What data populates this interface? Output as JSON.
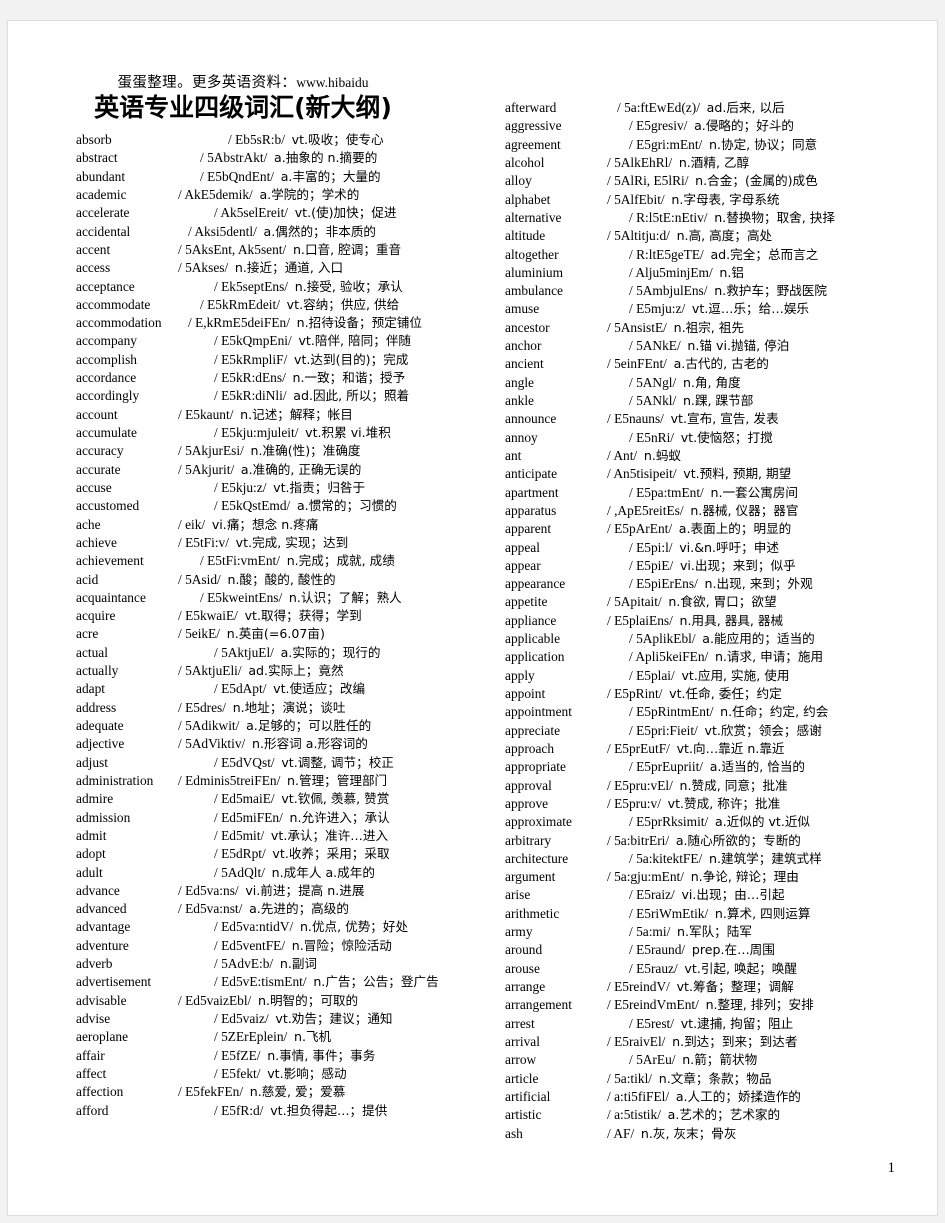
{
  "header": {
    "watermark_cn": "蛋蛋整理。更多英语资料：",
    "watermark_url": "www.hibaidu",
    "title": "英语专业四级词汇(新大纲)"
  },
  "page_number": "1",
  "columns": {
    "left": [
      {
        "word": "absorb",
        "gap": 5,
        "phonetic": "/ Eb5sR:b/",
        "definition": "vt.吸收；使专心"
      },
      {
        "word": "abstract",
        "gap": 3,
        "phonetic": "/ 5AbstrAkt/",
        "definition": "a.抽象的 n.摘要的"
      },
      {
        "word": "abundant",
        "gap": 3,
        "phonetic": "/ E5bQndEnt/",
        "definition": "a.丰富的；大量的"
      },
      {
        "word": "academic",
        "gap": 1,
        "phonetic": "/ AkE5demik/",
        "definition": "a.学院的；学术的"
      },
      {
        "word": "accelerate",
        "gap": 4,
        "phonetic": "/ Ak5selEreit/",
        "definition": "vt.(使)加快；促进"
      },
      {
        "word": "accidental",
        "gap": 2,
        "phonetic": "/ Aksi5dentl/",
        "definition": "a.偶然的；非本质的"
      },
      {
        "word": "accent",
        "gap": 1,
        "phonetic": "/ 5AksEnt, Ak5sent/",
        "definition": "n.口音, 腔调；重音"
      },
      {
        "word": "access",
        "gap": 1,
        "phonetic": "/ 5Akses/",
        "definition": "n.接近；通道, 入口"
      },
      {
        "word": "acceptance",
        "gap": 4,
        "phonetic": "/ Ek5septEns/",
        "definition": "n.接受, 验收；承认"
      },
      {
        "word": "accommodate",
        "gap": 3,
        "phonetic": "/ E5kRmEdeit/",
        "definition": "vt.容纳；供应, 供给"
      },
      {
        "word": "accommodation",
        "gap": 2,
        "phonetic": "/ E,kRmE5deiFEn/",
        "definition": "n.招待设备；预定铺位"
      },
      {
        "word": "accompany",
        "gap": 4,
        "phonetic": "/ E5kQmpEni/",
        "definition": "vt.陪伴, 陪同；伴随"
      },
      {
        "word": "accomplish",
        "gap": 4,
        "phonetic": "/ E5kRmpliF/",
        "definition": "vt.达到(目的)；完成"
      },
      {
        "word": "accordance",
        "gap": 4,
        "phonetic": "/ E5kR:dEns/",
        "definition": "n.一致；和谐；授予"
      },
      {
        "word": "accordingly",
        "gap": 4,
        "phonetic": "/ E5kR:diNli/",
        "definition": "ad.因此, 所以；照着"
      },
      {
        "word": "account",
        "gap": 1,
        "phonetic": "/ E5kaunt/",
        "definition": "n.记述；解释；帐目"
      },
      {
        "word": "accumulate",
        "gap": 4,
        "phonetic": "/ E5kju:mjuleit/",
        "definition": "vt.积累 vi.堆积"
      },
      {
        "word": "accuracy",
        "gap": 1,
        "phonetic": "/ 5AkjurEsi/",
        "definition": "n.准确(性)；准确度"
      },
      {
        "word": "accurate",
        "gap": 1,
        "phonetic": "/ 5Akjurit/",
        "definition": "a.准确的, 正确无误的"
      },
      {
        "word": "accuse",
        "gap": 4,
        "phonetic": "/ E5kju:z/",
        "definition": "vt.指责；归咎于"
      },
      {
        "word": "accustomed",
        "gap": 4,
        "phonetic": "/ E5kQstEmd/",
        "definition": "a.惯常的；习惯的"
      },
      {
        "word": "ache",
        "gap": 1,
        "phonetic": "/ eik/",
        "definition": "vi.痛；想念 n.疼痛"
      },
      {
        "word": "achieve",
        "gap": 1,
        "phonetic": "/ E5tFi:v/",
        "definition": "vt.完成, 实现；达到"
      },
      {
        "word": "achievement",
        "gap": 3,
        "phonetic": "/ E5tFi:vmEnt/",
        "definition": "n.完成；成就, 成绩"
      },
      {
        "word": "acid",
        "gap": 1,
        "phonetic": "/ 5Asid/",
        "definition": "n.酸；酸的, 酸性的"
      },
      {
        "word": "acquaintance",
        "gap": 3,
        "phonetic": "/ E5kweintEns/",
        "definition": "n.认识；了解；熟人"
      },
      {
        "word": "acquire",
        "gap": 1,
        "phonetic": "/ E5kwaiE/",
        "definition": "vt.取得；获得；学到"
      },
      {
        "word": "acre",
        "gap": 1,
        "phonetic": "/ 5eikE/",
        "definition": "n.英亩(=6.07亩)"
      },
      {
        "word": "actual",
        "gap": 4,
        "phonetic": "/ 5AktjuEl/",
        "definition": "a.实际的；现行的"
      },
      {
        "word": "actually",
        "gap": 1,
        "phonetic": "/ 5AktjuEli/",
        "definition": "ad.实际上；竟然"
      },
      {
        "word": "adapt",
        "gap": 4,
        "phonetic": "/ E5dApt/",
        "definition": "vt.使适应；改编"
      },
      {
        "word": "address",
        "gap": 1,
        "phonetic": "/ E5dres/",
        "definition": "n.地址；演说；谈吐"
      },
      {
        "word": "adequate",
        "gap": 1,
        "phonetic": "/ 5Adikwit/",
        "definition": "a.足够的；可以胜任的"
      },
      {
        "word": "adjective",
        "gap": 1,
        "phonetic": "/ 5AdViktiv/",
        "definition": "n.形容词 a.形容词的"
      },
      {
        "word": "adjust",
        "gap": 4,
        "phonetic": "/ E5dVQst/",
        "definition": "vt.调整, 调节；校正"
      },
      {
        "word": "administration",
        "gap": 1,
        "phonetic": "/ Edminis5treiFEn/",
        "definition": "n.管理；管理部门"
      },
      {
        "word": "admire",
        "gap": 4,
        "phonetic": "/ Ed5maiE/",
        "definition": "vt.钦佩, 羡慕, 赞赏"
      },
      {
        "word": "admission",
        "gap": 4,
        "phonetic": "/ Ed5miFEn/",
        "definition": "n.允许进入；承认"
      },
      {
        "word": "admit",
        "gap": 4,
        "phonetic": "/ Ed5mit/",
        "definition": "vt.承认；准许…进入"
      },
      {
        "word": "adopt",
        "gap": 4,
        "phonetic": "/ E5dRpt/",
        "definition": "vt.收养；采用；采取"
      },
      {
        "word": "adult",
        "gap": 4,
        "phonetic": "/ 5AdQlt/",
        "definition": "n.成年人 a.成年的"
      },
      {
        "word": "advance",
        "gap": 1,
        "phonetic": "/ Ed5va:ns/",
        "definition": "vi.前进；提高 n.进展"
      },
      {
        "word": "advanced",
        "gap": 1,
        "phonetic": "/ Ed5va:nst/",
        "definition": "a.先进的；高级的"
      },
      {
        "word": "advantage",
        "gap": 4,
        "phonetic": "/ Ed5va:ntidV/",
        "definition": "n.优点, 优势；好处"
      },
      {
        "word": "adventure",
        "gap": 4,
        "phonetic": "/ Ed5ventFE/",
        "definition": "n.冒险；惊险活动"
      },
      {
        "word": "adverb",
        "gap": 4,
        "phonetic": "/ 5AdvE:b/",
        "definition": "n.副词"
      },
      {
        "word": "advertisement",
        "gap": 4,
        "phonetic": "/ Ed5vE:tismEnt/",
        "definition": "n.广告；公告；登广告"
      },
      {
        "word": "advisable",
        "gap": 1,
        "phonetic": "/ Ed5vaizEbl/",
        "definition": "n.明智的；可取的"
      },
      {
        "word": "advise",
        "gap": 4,
        "phonetic": "/ Ed5vaiz/",
        "definition": "vt.劝告；建议；通知"
      },
      {
        "word": "aeroplane",
        "gap": 4,
        "phonetic": "/ 5ZErEplein/",
        "definition": "n.飞机"
      },
      {
        "word": "affair",
        "gap": 4,
        "phonetic": "/ E5fZE/",
        "definition": "n.事情, 事件；事务"
      },
      {
        "word": "affect",
        "gap": 4,
        "phonetic": "/ E5fekt/",
        "definition": "vt.影响；感动"
      },
      {
        "word": "affection",
        "gap": 1,
        "phonetic": "/ E5fekFEn/",
        "definition": "n.慈爱, 爱；爱慕"
      },
      {
        "word": "afford",
        "gap": 4,
        "phonetic": "/ E5fR:d/",
        "definition": "vt.担负得起…；提供"
      }
    ],
    "right": [
      {
        "word": "afterward",
        "gap": 2,
        "phonetic": "/ 5a:ftEwEd(z)/",
        "definition": "ad.后来, 以后"
      },
      {
        "word": "aggressive",
        "gap": 3,
        "phonetic": "/ E5gresiv/",
        "definition": "a.侵略的；好斗的"
      },
      {
        "word": "agreement",
        "gap": 3,
        "phonetic": "/ E5gri:mEnt/",
        "definition": "n.协定, 协议；同意"
      },
      {
        "word": "alcohol",
        "gap": 1,
        "phonetic": "/ 5AlkEhRl/",
        "definition": "n.酒精, 乙醇"
      },
      {
        "word": "alloy",
        "gap": 1,
        "phonetic": "/ 5AlRi, E5lRi/",
        "definition": "n.合金；(金属的)成色"
      },
      {
        "word": "alphabet",
        "gap": 1,
        "phonetic": "/ 5AlfEbit/",
        "definition": "n.字母表, 字母系统"
      },
      {
        "word": "alternative",
        "gap": 3,
        "phonetic": "/ R:l5tE:nEtiv/",
        "definition": "n.替换物；取舍, 抉择"
      },
      {
        "word": "altitude",
        "gap": 1,
        "phonetic": "/ 5Altitju:d/",
        "definition": "n.高, 高度；高处"
      },
      {
        "word": "altogether",
        "gap": 3,
        "phonetic": "/ R:ltE5geTE/",
        "definition": "ad.完全；总而言之"
      },
      {
        "word": "aluminium",
        "gap": 3,
        "phonetic": "/ Alju5minjEm/",
        "definition": "n.铝"
      },
      {
        "word": "ambulance",
        "gap": 3,
        "phonetic": "/ 5AmbjulEns/",
        "definition": "n.救护车；野战医院"
      },
      {
        "word": "amuse",
        "gap": 3,
        "phonetic": "/ E5mju:z/",
        "definition": "vt.逗…乐；给…娱乐"
      },
      {
        "word": "ancestor",
        "gap": 1,
        "phonetic": "/ 5AnsistE/",
        "definition": "n.祖宗, 祖先"
      },
      {
        "word": "anchor",
        "gap": 3,
        "phonetic": "/ 5ANkE/",
        "definition": "n.锚 vi.抛锚, 停泊"
      },
      {
        "word": "ancient",
        "gap": 1,
        "phonetic": "/ 5einFEnt/",
        "definition": "a.古代的, 古老的"
      },
      {
        "word": "angle",
        "gap": 3,
        "phonetic": "/ 5ANgl/",
        "definition": "n.角, 角度"
      },
      {
        "word": "ankle",
        "gap": 3,
        "phonetic": "/ 5ANkl/",
        "definition": "n.踝, 踝节部"
      },
      {
        "word": "announce",
        "gap": 1,
        "phonetic": "/ E5nauns/",
        "definition": "vt.宣布, 宣告, 发表"
      },
      {
        "word": "annoy",
        "gap": 3,
        "phonetic": "/ E5nRi/",
        "definition": "vt.使恼怒；打搅"
      },
      {
        "word": "ant",
        "gap": 1,
        "phonetic": "/ Ant/",
        "definition": "n.蚂蚁"
      },
      {
        "word": "anticipate",
        "gap": 1,
        "phonetic": "/ An5tisipeit/",
        "definition": "vt.预料, 预期, 期望"
      },
      {
        "word": "apartment",
        "gap": 3,
        "phonetic": "/ E5pa:tmEnt/",
        "definition": "n.一套公寓房间"
      },
      {
        "word": "apparatus",
        "gap": 1,
        "phonetic": "/ ,ApE5reitEs/",
        "definition": "n.器械, 仪器；器官"
      },
      {
        "word": "apparent",
        "gap": 1,
        "phonetic": "/ E5pArEnt/",
        "definition": "a.表面上的；明显的"
      },
      {
        "word": "appeal",
        "gap": 3,
        "phonetic": "/ E5pi:l/",
        "definition": "vi.&n.呼吁；申述"
      },
      {
        "word": "appear",
        "gap": 3,
        "phonetic": "/ E5piE/",
        "definition": "vi.出现；来到；似乎"
      },
      {
        "word": "appearance",
        "gap": 3,
        "phonetic": "/ E5piErEns/",
        "definition": "n.出现, 来到；外观"
      },
      {
        "word": "appetite",
        "gap": 1,
        "phonetic": "/ 5Apitait/",
        "definition": "n.食欲, 胃口；欲望"
      },
      {
        "word": "appliance",
        "gap": 1,
        "phonetic": "/ E5plaiEns/",
        "definition": "n.用具, 器具, 器械"
      },
      {
        "word": "applicable",
        "gap": 3,
        "phonetic": "/ 5AplikEbl/",
        "definition": "a.能应用的；适当的"
      },
      {
        "word": "application",
        "gap": 3,
        "phonetic": "/ Apli5keiFEn/",
        "definition": "n.请求, 申请；施用"
      },
      {
        "word": "apply",
        "gap": 3,
        "phonetic": "/ E5plai/",
        "definition": "vt.应用, 实施, 使用"
      },
      {
        "word": "appoint",
        "gap": 1,
        "phonetic": "/ E5pRint/",
        "definition": "vt.任命, 委任；约定"
      },
      {
        "word": "appointment",
        "gap": 3,
        "phonetic": "/ E5pRintmEnt/",
        "definition": "n.任命；约定, 约会"
      },
      {
        "word": "appreciate",
        "gap": 3,
        "phonetic": "/ E5pri:Fieit/",
        "definition": "vt.欣赏；领会；感谢"
      },
      {
        "word": "approach",
        "gap": 1,
        "phonetic": "/ E5prEutF/",
        "definition": "vt.向…靠近 n.靠近"
      },
      {
        "word": "appropriate",
        "gap": 3,
        "phonetic": "/ E5prEupriit/",
        "definition": "a.适当的, 恰当的"
      },
      {
        "word": "approval",
        "gap": 1,
        "phonetic": "/ E5pru:vEl/",
        "definition": "n.赞成, 同意；批准"
      },
      {
        "word": "approve",
        "gap": 1,
        "phonetic": "/ E5pru:v/",
        "definition": "vt.赞成, 称许；批准"
      },
      {
        "word": "approximate",
        "gap": 3,
        "phonetic": "/ E5prRksimit/",
        "definition": "a.近似的 vt.近似"
      },
      {
        "word": "arbitrary",
        "gap": 1,
        "phonetic": "/ 5a:bitrEri/",
        "definition": "a.随心所欲的；专断的"
      },
      {
        "word": "architecture",
        "gap": 3,
        "phonetic": "/ 5a:kitektFE/",
        "definition": "n.建筑学；建筑式样"
      },
      {
        "word": "argument",
        "gap": 1,
        "phonetic": "/ 5a:gju:mEnt/",
        "definition": "n.争论, 辩论；理由"
      },
      {
        "word": "arise",
        "gap": 3,
        "phonetic": "/ E5raiz/",
        "definition": "vi.出现；由…引起"
      },
      {
        "word": "arithmetic",
        "gap": 3,
        "phonetic": "/ E5riWmEtik/",
        "definition": "n.算术, 四则运算"
      },
      {
        "word": "army",
        "gap": 3,
        "phonetic": "/ 5a:mi/",
        "definition": "n.军队；陆军"
      },
      {
        "word": "around",
        "gap": 3,
        "phonetic": "/ E5raund/",
        "definition": "prep.在…周围"
      },
      {
        "word": "arouse",
        "gap": 3,
        "phonetic": "/ E5rauz/",
        "definition": "vt.引起, 唤起；唤醒"
      },
      {
        "word": "arrange",
        "gap": 1,
        "phonetic": "/ E5reindV/",
        "definition": "vt.筹备；整理；调解"
      },
      {
        "word": "arrangement",
        "gap": 1,
        "phonetic": "/ E5reindVmEnt/",
        "definition": "n.整理, 排列；安排"
      },
      {
        "word": "arrest",
        "gap": 3,
        "phonetic": "/ E5rest/",
        "definition": "vt.逮捕, 拘留；阻止"
      },
      {
        "word": "arrival",
        "gap": 1,
        "phonetic": "/ E5raivEl/",
        "definition": "n.到达；到来；到达者"
      },
      {
        "word": "arrow",
        "gap": 3,
        "phonetic": "/ 5ArEu/",
        "definition": "n.箭；箭状物"
      },
      {
        "word": "article",
        "gap": 1,
        "phonetic": "/ 5a:tikl/",
        "definition": "n.文章；条款；物品"
      },
      {
        "word": "artificial",
        "gap": 1,
        "phonetic": "/ a:ti5fiFEl/",
        "definition": "a.人工的；娇揉造作的"
      },
      {
        "word": "artistic",
        "gap": 1,
        "phonetic": "/ a:5tistik/",
        "definition": "a.艺术的；艺术家的"
      },
      {
        "word": "ash",
        "gap": 1,
        "phonetic": "/ AF/",
        "definition": "n.灰, 灰末；骨灰"
      }
    ]
  }
}
